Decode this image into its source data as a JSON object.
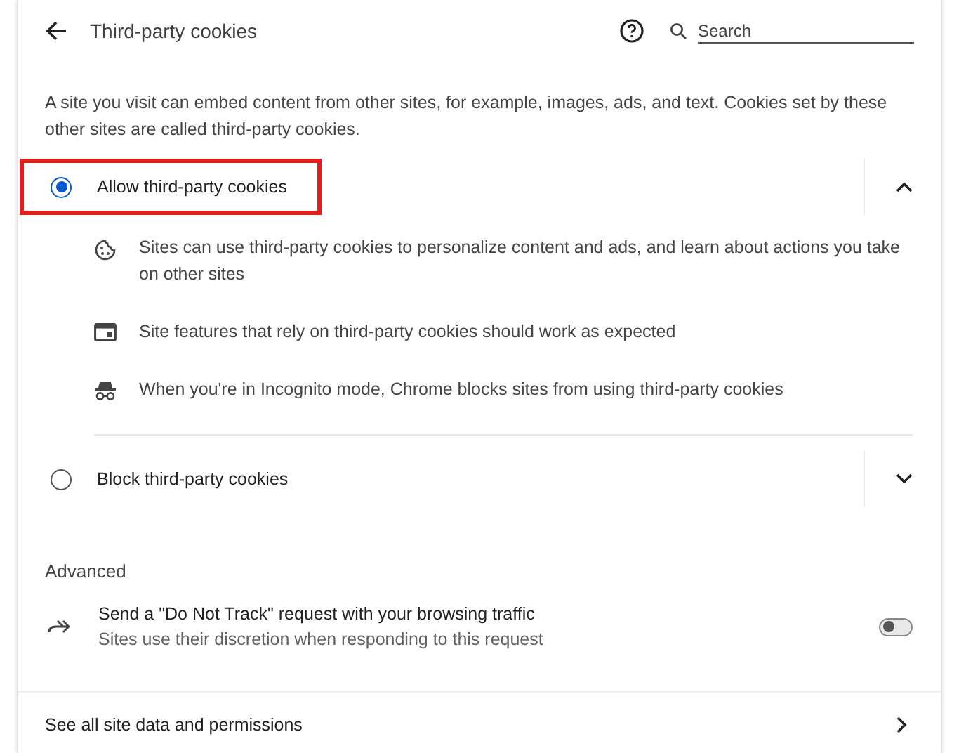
{
  "header": {
    "title": "Third-party cookies",
    "search": {
      "placeholder": "Search"
    }
  },
  "description": "A site you visit can embed content from other sites, for example, images, ads, and text. Cookies set by these other sites are called third-party cookies.",
  "options": [
    {
      "label": "Allow third-party cookies",
      "selected": true,
      "expanded": true,
      "highlighted": true,
      "details": [
        {
          "kind": "cookie",
          "text": "Sites can use third-party cookies to personalize content and ads, and learn about actions you take on other sites"
        },
        {
          "kind": "site",
          "text": "Site features that rely on third-party cookies should work as expected"
        },
        {
          "kind": "incognito",
          "text": "When you're in Incognito mode, Chrome blocks sites from using third-party cookies"
        }
      ]
    },
    {
      "label": "Block third-party cookies",
      "selected": false,
      "expanded": false,
      "highlighted": false
    }
  ],
  "advanced": {
    "heading": "Advanced",
    "setting": {
      "title": "Send a \"Do Not Track\" request with your browsing traffic",
      "subtitle": "Sites use their discretion when responding to this request",
      "on": false
    }
  },
  "link": {
    "label": "See all site data and permissions"
  }
}
